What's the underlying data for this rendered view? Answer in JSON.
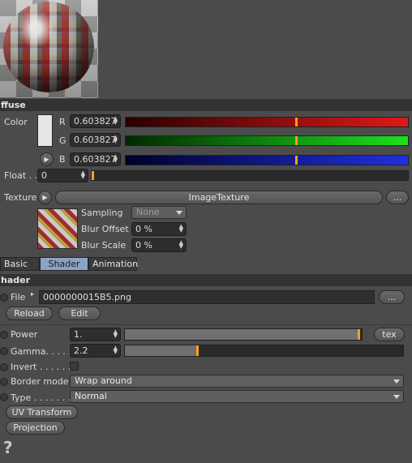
{
  "diffuse_section": {
    "title": "ffuse",
    "color_label": "Color",
    "channels": [
      {
        "label": "R",
        "value": "0.603827",
        "fraction": 0.603827,
        "color": "#e01818"
      },
      {
        "label": "G",
        "value": "0.603827",
        "fraction": 0.603827,
        "color": "#1ee01e"
      },
      {
        "label": "B",
        "value": "0.603827",
        "fraction": 0.603827,
        "color": "#2030e0"
      }
    ],
    "swatch_color": "#e6e6e6",
    "float_label": "Float . .",
    "float_value": "0",
    "float_fraction": 0,
    "texture_label": "Texture",
    "texture_name": "ImageTexture",
    "texture_more": "...",
    "sampling_label": "Sampling",
    "sampling_value": "None",
    "blur_offset_label": "Blur Offset",
    "blur_offset_value": "0 %",
    "blur_scale_label": "Blur Scale",
    "blur_scale_value": "0 %"
  },
  "tabs": [
    {
      "label": "Basic",
      "active": false
    },
    {
      "label": "Shader",
      "active": true
    },
    {
      "label": "Animation",
      "active": false
    }
  ],
  "shader_section": {
    "title": "hader",
    "file_label": "File",
    "file_value": "0000000015B5.png",
    "file_more": "...",
    "reload_label": "Reload",
    "edit_label": "Edit",
    "power_label": "Power",
    "power_value": "1.",
    "power_fraction": 0.99,
    "tex_label": "tex",
    "gamma_label": "Gamma. . . . .",
    "gamma_value": "2.2",
    "gamma_fraction": 0.26,
    "invert_label": "Invert . . . . . .",
    "border_mode_label": "Border mode",
    "border_mode_value": "Wrap around",
    "type_label": "Type . . . . . . . .",
    "type_value": "Normal",
    "uv_transform_label": "UV Transform",
    "projection_label": "Projection",
    "help_glyph": "?"
  }
}
